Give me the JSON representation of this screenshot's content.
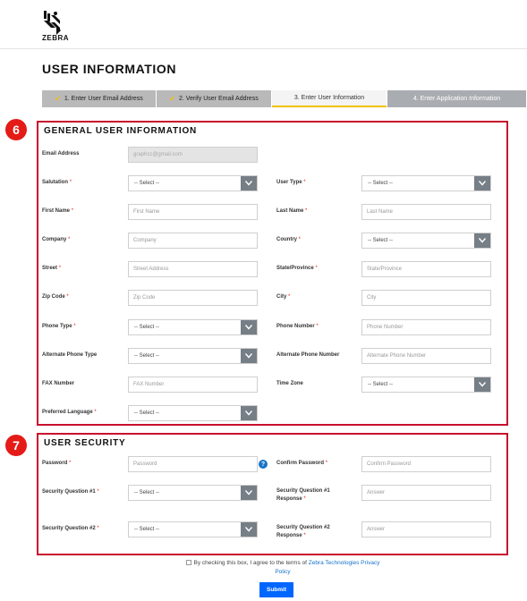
{
  "brand": {
    "name": "ZEBRA"
  },
  "page_title": "USER INFORMATION",
  "steps": [
    {
      "label": "1. Enter User Email Address",
      "state": "done"
    },
    {
      "label": "2. Verify User Email Address",
      "state": "done"
    },
    {
      "label": "3. Enter User Information",
      "state": "active"
    },
    {
      "label": "4. Enter Application Information",
      "state": "todo"
    }
  ],
  "general": {
    "badge": "6",
    "title": "GENERAL USER INFORMATION",
    "email": {
      "label": "Email Address",
      "value": "graphcc@gmail.com"
    },
    "salutation": {
      "label": "Salutation",
      "value": "-- Select --"
    },
    "user_type": {
      "label": "User Type",
      "value": "-- Select --"
    },
    "first_name": {
      "label": "First Name",
      "placeholder": "First Name"
    },
    "last_name": {
      "label": "Last Name",
      "placeholder": "Last Name"
    },
    "company": {
      "label": "Company",
      "placeholder": "Company"
    },
    "country": {
      "label": "Country",
      "value": "-- Select --"
    },
    "street": {
      "label": "Street",
      "placeholder": "Street Address"
    },
    "state": {
      "label": "State/Province",
      "placeholder": "State/Province"
    },
    "zip": {
      "label": "Zip Code",
      "placeholder": "Zip Code"
    },
    "city": {
      "label": "City",
      "placeholder": "City"
    },
    "phone_type": {
      "label": "Phone Type",
      "value": "-- Select --"
    },
    "phone_number": {
      "label": "Phone Number",
      "placeholder": "Phone Number"
    },
    "alt_phone_type": {
      "label": "Alternate Phone Type",
      "value": "-- Select --"
    },
    "alt_phone_number": {
      "label": "Alternate Phone Number",
      "placeholder": "Alternate Phone Number"
    },
    "fax": {
      "label": "FAX Number",
      "placeholder": "FAX Number"
    },
    "time_zone": {
      "label": "Time Zone",
      "value": "-- Select --"
    },
    "pref_lang": {
      "label": "Preferred Language",
      "value": "-- Select --"
    }
  },
  "security": {
    "badge": "7",
    "title": "USER SECURITY",
    "password": {
      "label": "Password",
      "placeholder": "Password",
      "help": "?"
    },
    "confirm_password": {
      "label": "Confirm Password",
      "placeholder": "Confirm Password"
    },
    "q1": {
      "label": "Security Question #1",
      "value": "-- Select --"
    },
    "q1_resp": {
      "label_line1": "Security Question #1",
      "label_line2": "Response",
      "placeholder": "Answer"
    },
    "q2": {
      "label": "Security Question #2",
      "value": "-- Select --"
    },
    "q2_resp": {
      "label_line1": "Security Question #2",
      "label_line2": "Response",
      "placeholder": "Answer"
    }
  },
  "required_mark": "*",
  "agree": {
    "text": "By checking this box, I agree to the terms of ",
    "link1": "Zebra Technologies Privacy",
    "link2": "Policy"
  },
  "submit_label": "Submit",
  "colors": {
    "accent": "#f2c200",
    "highlight": "#c8102e",
    "link": "#1673c8",
    "submit": "#0066ff"
  }
}
